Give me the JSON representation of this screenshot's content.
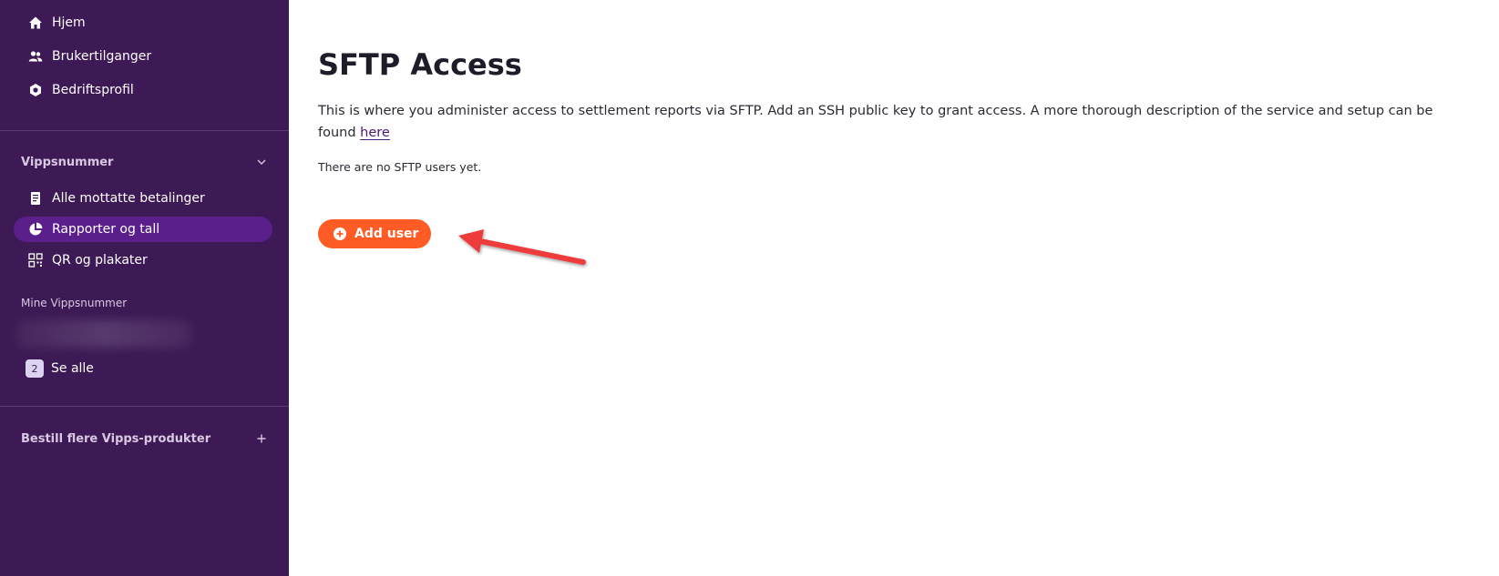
{
  "sidebar": {
    "top_items": [
      {
        "label": "Hjem",
        "icon": "home-icon"
      },
      {
        "label": "Brukertilganger",
        "icon": "users-icon"
      },
      {
        "label": "Bedriftsprofil",
        "icon": "company-icon"
      }
    ],
    "vippsnummer": {
      "title": "Vippsnummer",
      "items": [
        {
          "label": "Alle mottatte betalinger",
          "icon": "receipt-icon"
        },
        {
          "label": "Rapporter og tall",
          "icon": "pie-chart-icon",
          "active": true
        },
        {
          "label": "QR og plakater",
          "icon": "qr-icon"
        }
      ]
    },
    "mine": {
      "title": "Mine Vippsnummer",
      "see_all_count": "2",
      "see_all_label": "Se alle"
    },
    "order": {
      "title": "Bestill flere Vipps-produkter"
    },
    "colors": {
      "background": "#3d1a55",
      "active": "#5b1f8c"
    }
  },
  "main": {
    "title": "SFTP Access",
    "description": "This is where you administer access to settlement reports via SFTP. Add an SSH public key to grant access. A more thorough description of the service and setup can be found ",
    "link_label": "here",
    "empty_text": "There are no SFTP users yet.",
    "add_button_label": "Add user",
    "colors": {
      "accent": "#ff5b24",
      "arrow": "#ee3b3b"
    }
  }
}
